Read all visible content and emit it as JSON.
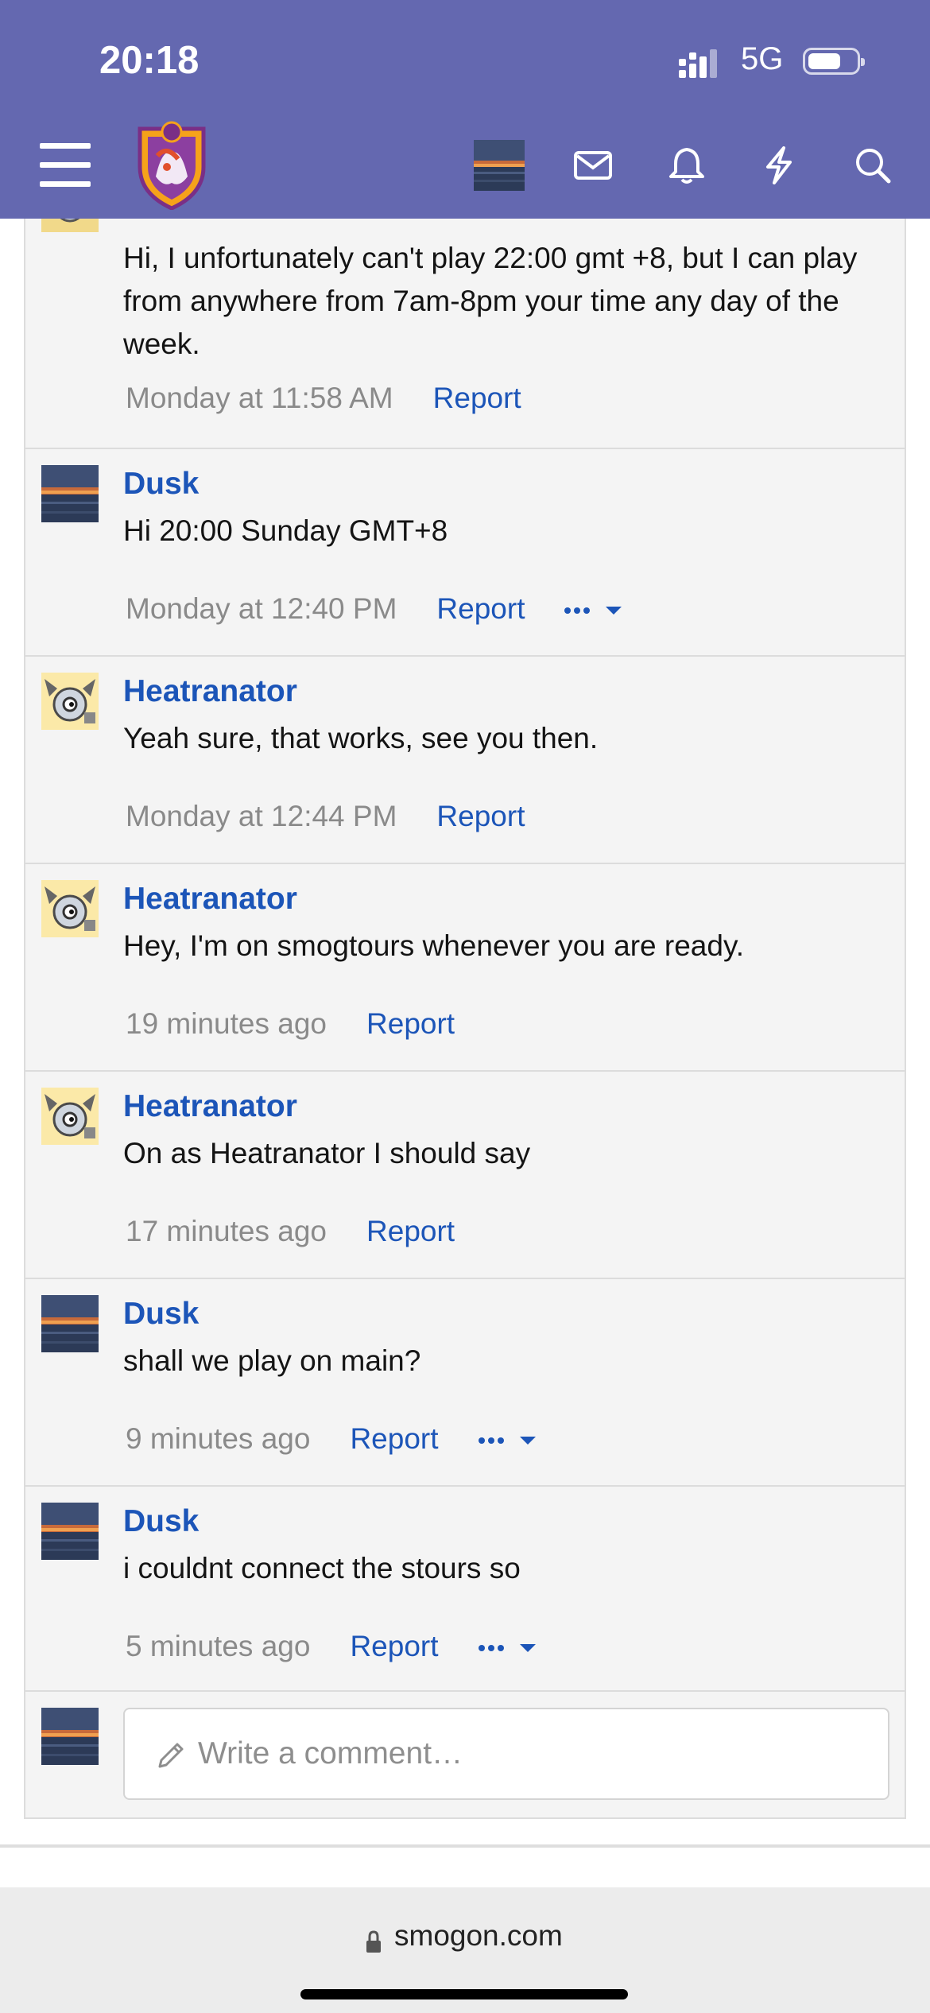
{
  "status_bar": {
    "time": "20:18",
    "network": "5G"
  },
  "header": {
    "logo": "smogon-shield-logo"
  },
  "comments": [
    {
      "author": "",
      "text": "Hi, I unfortunately can't play 22:00 gmt +8, but I can play from anywhere from 7am-8pm your time any day of the week.",
      "time": "Monday at 11:58 AM",
      "report": "Report",
      "has_more": false
    },
    {
      "author": "Dusk",
      "text": "Hi 20:00 Sunday GMT+8",
      "time": "Monday at 12:40 PM",
      "report": "Report",
      "has_more": true
    },
    {
      "author": "Heatranator",
      "text": "Yeah sure, that works, see you then.",
      "time": "Monday at 12:44 PM",
      "report": "Report",
      "has_more": false
    },
    {
      "author": "Heatranator",
      "text": "Hey, I'm on smogtours whenever you are ready.",
      "time": "19 minutes ago",
      "report": "Report",
      "has_more": false
    },
    {
      "author": "Heatranator",
      "text": "On as Heatranator I should say",
      "time": "17 minutes ago",
      "report": "Report",
      "has_more": false
    },
    {
      "author": "Dusk",
      "text": "shall we play on main?",
      "time": "9 minutes ago",
      "report": "Report",
      "has_more": true
    },
    {
      "author": "Dusk",
      "text": "i couldnt connect the stours so",
      "time": "5 minutes ago",
      "report": "Report",
      "has_more": true
    }
  ],
  "compose": {
    "placeholder": "Write a comment…"
  },
  "browser": {
    "url": "smogon.com"
  },
  "colors": {
    "header_bg": "#6468b0",
    "link": "#1c55b8"
  }
}
